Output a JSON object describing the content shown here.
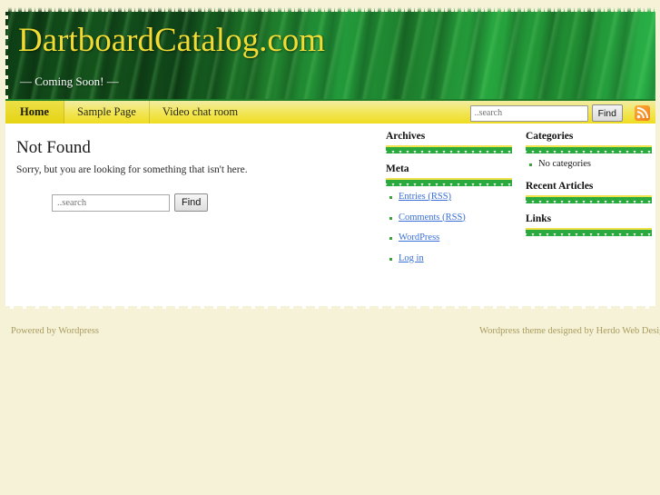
{
  "site": {
    "title": "DartboardCatalog.com",
    "tagline": "— Coming Soon! —",
    "colors": {
      "header_green_dark": "#0d3d15",
      "header_green_light": "#2bb54a",
      "title_yellow": "#f2dc34",
      "nav_yellow": "#efdc22",
      "page_cream": "#f6f2d8",
      "link_blue": "#3a6fd8",
      "rss_orange": "#f07c1b",
      "footer_text": "#a99c5e"
    }
  },
  "nav": {
    "items": [
      {
        "label": "Home",
        "active": true
      },
      {
        "label": "Sample Page",
        "active": false
      },
      {
        "label": "Video chat room",
        "active": false
      }
    ],
    "search": {
      "placeholder": "..search",
      "value": "",
      "button_label": "Find"
    },
    "rss_icon": "rss-feed-icon"
  },
  "main": {
    "heading": "Not Found",
    "body": "Sorry, but you are looking for something that isn't here.",
    "search": {
      "placeholder": "..search",
      "value": "",
      "button_label": "Find"
    }
  },
  "sidebar_left": {
    "widgets": [
      {
        "title": "Archives",
        "items": []
      },
      {
        "title": "Meta",
        "items": [
          {
            "label": "Entries (RSS)",
            "link": true
          },
          {
            "label": "Comments (RSS)",
            "link": true
          },
          {
            "label": "WordPress",
            "link": true
          },
          {
            "label": "Log in",
            "link": true
          }
        ]
      }
    ]
  },
  "sidebar_right": {
    "widgets": [
      {
        "title": "Categories",
        "items": [
          {
            "label": "No categories",
            "link": false
          }
        ]
      },
      {
        "title": "Recent Articles",
        "items": []
      },
      {
        "title": "Links",
        "items": []
      }
    ]
  },
  "footer": {
    "left": "Powered by Wordpress",
    "right": "Wordpress theme designed by Herdo Web Design"
  }
}
